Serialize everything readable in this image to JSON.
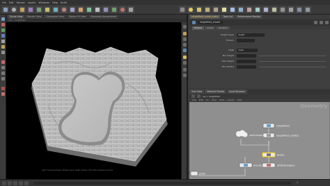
{
  "menubar": {
    "items": [
      "File",
      "Edit",
      "Render",
      "Assets",
      "Windows",
      "Help",
      "Build"
    ]
  },
  "shelf": {
    "tabs": [
      "Create",
      "Modify",
      "Model",
      "Polygon",
      "Deform",
      "Texture",
      "Rigging",
      "Characters",
      "Constraints",
      "Hair Utils",
      "Guide Process",
      "Terrain FX"
    ]
  },
  "viewport": {
    "tabs": [
      "Scene View",
      "Render View",
      "Composite View",
      "Motion FX View",
      "Geometry Spreadsheet"
    ],
    "path": "obj > heightfield",
    "status": "Left mouse tumbles. Middle pans. Right dollies. Ctrl+Alt+Left box-zooms."
  },
  "params": {
    "tabs": [
      "heightfield_erode_hydro",
      "Take List",
      "Performance Monitor"
    ],
    "node_name": "heightfield_erode1",
    "sub_tabs": [
      "Erosion",
      "Adjust",
      "Visualize"
    ],
    "rows": [
      {
        "label": "Height Layer",
        "value": "height"
      },
      {
        "label": "Erosion",
        "value": ""
      },
      {
        "label": "Mask",
        "value": "mask"
      },
      {
        "label": "Min Height",
        "value": ""
      },
      {
        "label": "Max Height",
        "value": ""
      },
      {
        "label": "Blur Radius",
        "value": ""
      }
    ]
  },
  "network": {
    "tabs": [
      "Tree View",
      "Material Palette",
      "Asset Browser"
    ],
    "path": "obj > heightfield",
    "menu": [
      "Add",
      "Edit",
      "Go",
      "View",
      "Tools",
      "Layout",
      "Help"
    ],
    "title": "Geometry",
    "nodes": [
      {
        "id": "heightfield",
        "label": "heightfield"
      },
      {
        "id": "heightfield_erode",
        "label": "heightfield_erode1"
      },
      {
        "id": "volumevop",
        "label": "volumevop1"
      },
      {
        "id": "null",
        "label": "OUT"
      },
      {
        "id": "blast",
        "label": "blast1"
      },
      {
        "id": "merge",
        "label": "merge1"
      },
      {
        "id": "grid",
        "label": "grid1"
      },
      {
        "id": "mountain",
        "label": "mountain1"
      },
      {
        "id": "attribwrangle",
        "label": "attribwrangle1"
      }
    ]
  },
  "timeline": {
    "frame": "1"
  },
  "colors": {
    "accent": "#e8c36a",
    "selected": "#f2c200",
    "node_blue": "#6aa0c8"
  }
}
